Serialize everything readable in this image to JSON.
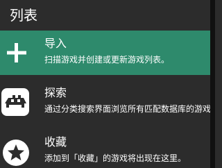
{
  "header": {
    "title": "列表"
  },
  "menu": {
    "items": [
      {
        "label": "导入",
        "sublabel": "扫描游戏并创建或更新游戏列表。",
        "icon": "plus-icon",
        "selected": true
      },
      {
        "label": "探索",
        "sublabel": "通过分类搜索界面浏览所有匹配数据库的游戏。",
        "icon": "retroarch-invader-icon",
        "selected": false
      },
      {
        "label": "收藏",
        "sublabel": "添加到「收藏」的游戏将出现在这里。",
        "icon": "star-icon",
        "selected": false
      }
    ]
  },
  "colors": {
    "background": "#2c2c2c",
    "selected": "#2e8a6c",
    "text": "#ffffff",
    "edge": "#111111"
  }
}
